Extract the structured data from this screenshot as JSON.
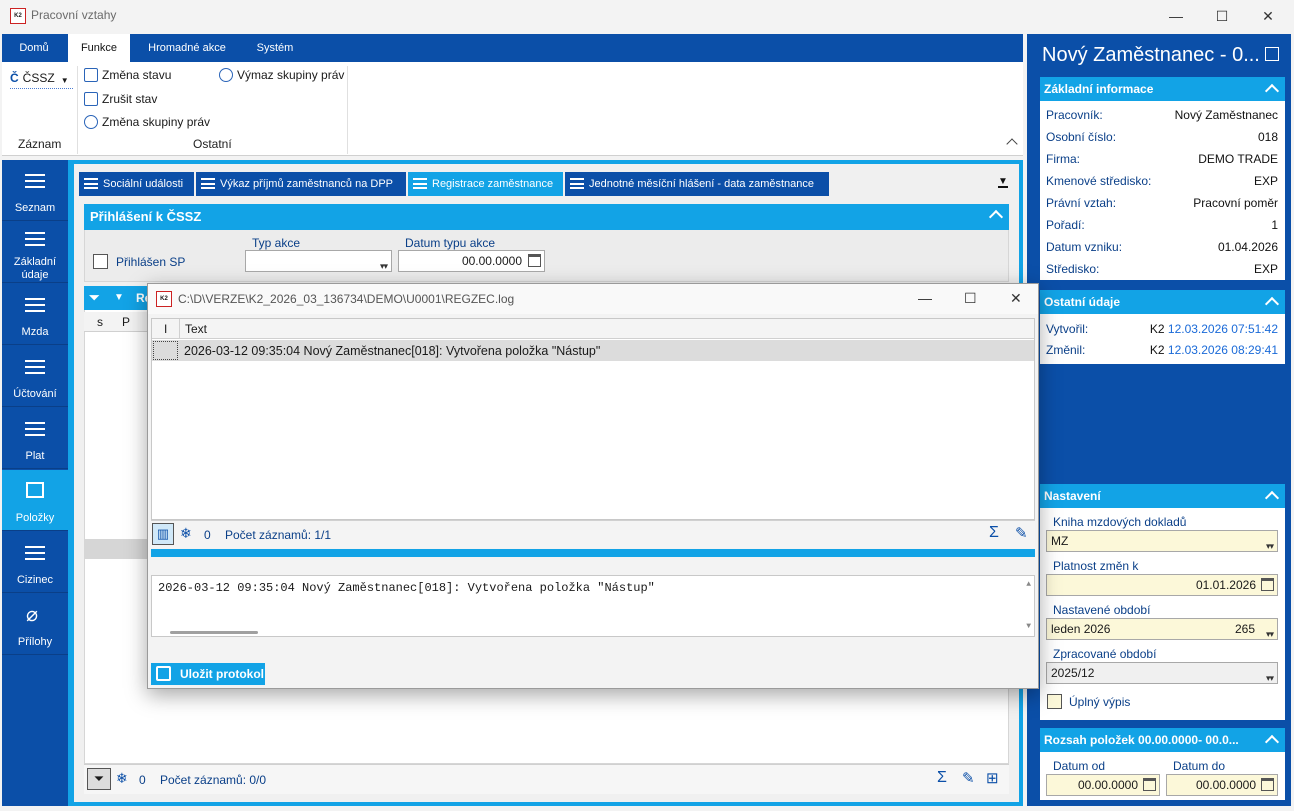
{
  "window": {
    "title": "Pracovní vztahy",
    "logo_text": "K2",
    "controls": {
      "minimize": "—",
      "maximize": "☐",
      "close": "✕"
    }
  },
  "ribbon": {
    "tabs": [
      "Domů",
      "Funkce",
      "Hromadné akce",
      "Systém"
    ],
    "active_tab": "Funkce",
    "cssz_label": "ČSSZ",
    "cssz_glyph": "Č",
    "items": {
      "zmena_stavu": "Změna stavu",
      "zrusit_stav": "Zrušit stav",
      "zmena_skupiny": "Změna skupiny práv",
      "vymaz_skupiny": "Výmaz skupiny práv"
    },
    "groups": {
      "zaznam": "Záznam",
      "ostatni": "Ostatní"
    }
  },
  "leftnav": [
    {
      "label": "Seznam"
    },
    {
      "label": "Základní údaje"
    },
    {
      "label": "Mzda"
    },
    {
      "label": "Účtování"
    },
    {
      "label": "Plat"
    },
    {
      "label": "Položky",
      "active": true
    },
    {
      "label": "Cizinec"
    },
    {
      "label": "Přílohy"
    }
  ],
  "content_tabs": [
    {
      "label": "Sociální události"
    },
    {
      "label": "Výkaz příjmů zaměstnanců na DPP"
    },
    {
      "label": "Registrace zaměstnance",
      "active": true
    },
    {
      "label": "Jednotné měsíční hlášení - data zaměstnance"
    }
  ],
  "prihlaseni": {
    "heading": "Přihlášení k ČSSZ",
    "checkbox_label": "Přihlášen SP",
    "typ_akce_label": "Typ akce",
    "typ_akce_value": "",
    "datum_label": "Datum typu akce",
    "datum_value": "00.00.0000"
  },
  "list": {
    "heading_partial": "Re",
    "columns": [
      "s",
      "P"
    ],
    "count": "0",
    "record_count": "Počet záznamů: 0/0"
  },
  "dialog": {
    "title": "C:\\D\\VERZE\\K2_2026_03_136734\\DEMO\\U0001\\REGZEC.log",
    "col_i": "I",
    "col_text": "Text",
    "rows": [
      "2026-03-12 09:35:04 Nový Zaměstnanec[018]: Vytvořena položka \"Nástup\""
    ],
    "count": "0",
    "record_count": "Počet záznamů: 1/1",
    "detail_text": "2026-03-12 09:35:04 Nový Zaměstnanec[018]: Vytvořena položka \"Nástup\"",
    "save_label": "Uložit protokol"
  },
  "rightpanel": {
    "title": "Nový Zaměstnanec - 0...",
    "zakladni": {
      "heading": "Základní informace",
      "rows": [
        {
          "k": "Pracovník:",
          "v": "Nový Zaměstnanec"
        },
        {
          "k": "Osobní číslo:",
          "v": "018"
        },
        {
          "k": "Firma:",
          "v": "DEMO TRADE"
        },
        {
          "k": "Kmenové středisko:",
          "v": "EXP"
        },
        {
          "k": "Právní vztah:",
          "v": "Pracovní poměr"
        },
        {
          "k": "Pořadí:",
          "v": "1"
        },
        {
          "k": "Datum vzniku:",
          "v": "01.04.2026"
        },
        {
          "k": "Středisko:",
          "v": "EXP"
        }
      ]
    },
    "ostatni": {
      "heading": "Ostatní údaje",
      "vytvoril_label": "Vytvořil:",
      "vytvoril_user": "K2",
      "vytvoril_date": "12.03.2026 07:51:42",
      "zmenil_label": "Změnil:",
      "zmenil_user": "K2",
      "zmenil_date": "12.03.2026 08:29:41"
    },
    "nastaveni": {
      "heading": "Nastavení",
      "kniha_label": "Kniha mzdových dokladů",
      "kniha_value": "MZ",
      "platnost_label": "Platnost změn k",
      "platnost_value": "01.01.2026",
      "obdobi_label": "Nastavené období",
      "obdobi_value": "leden 2026",
      "obdobi_num": "265",
      "zprac_label": "Zpracované období",
      "zprac_value": "2025/12",
      "uplny_label": "Úplný výpis"
    },
    "rozsah": {
      "heading": "Rozsah položek 00.00.0000- 00.0...",
      "od_label": "Datum od",
      "od_value": "00.00.0000",
      "do_label": "Datum do",
      "do_value": "00.00.0000"
    }
  }
}
